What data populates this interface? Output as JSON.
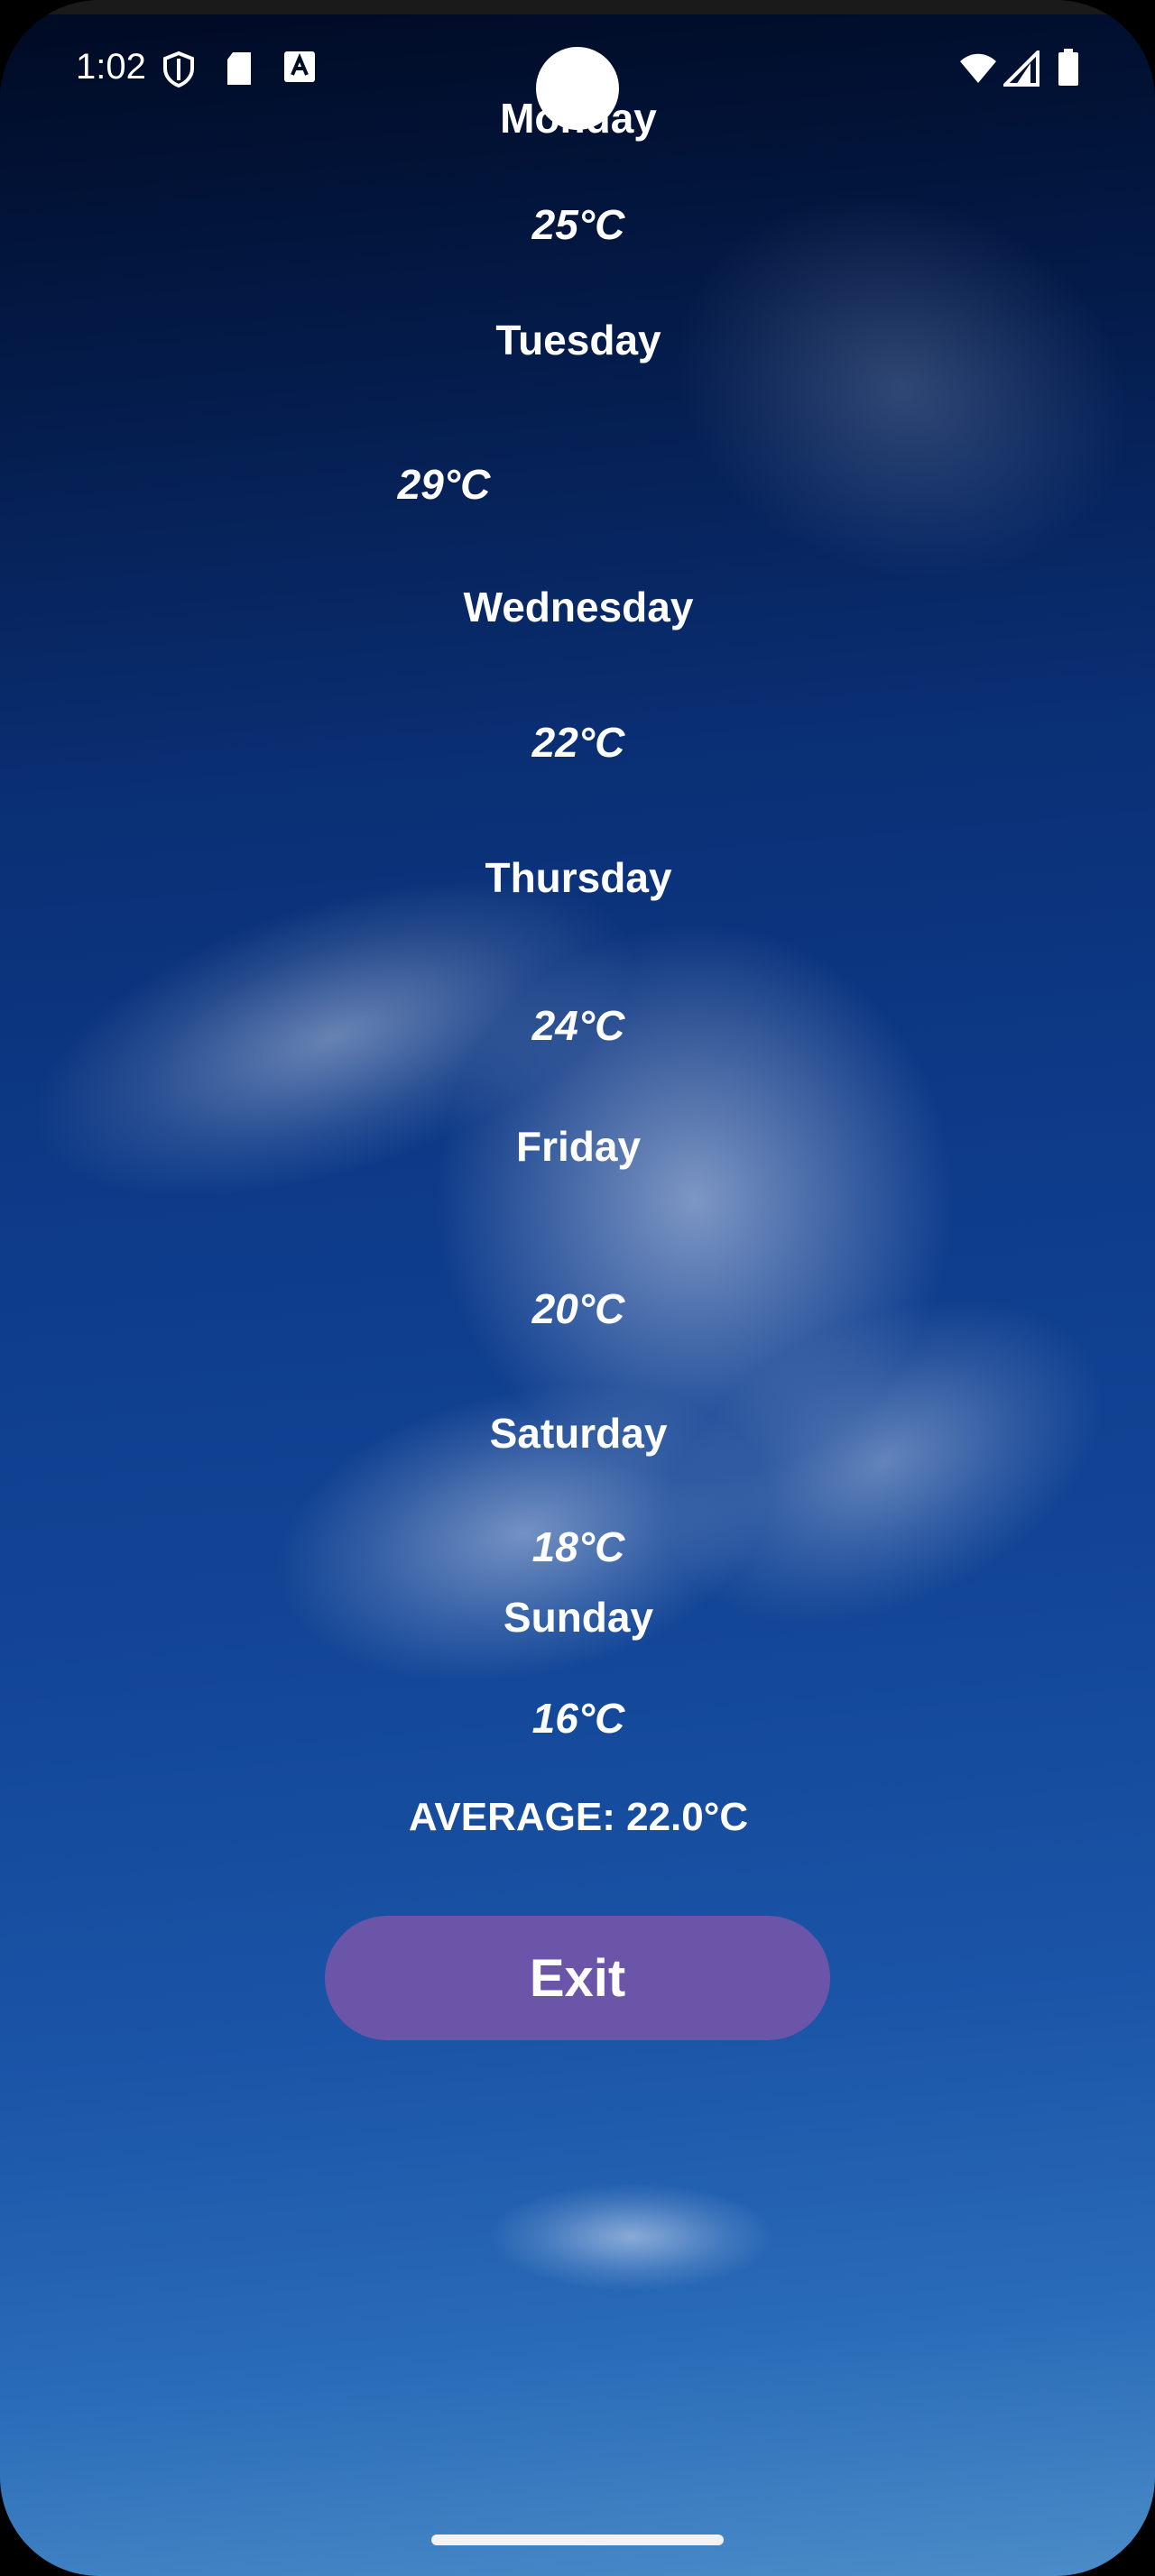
{
  "status_bar": {
    "time": "1:02",
    "icons": [
      "shield-icon",
      "sd-card-icon",
      "font-a-icon",
      "wifi-icon",
      "cellular-signal-icon",
      "battery-icon"
    ]
  },
  "forecast": [
    {
      "day": "Monday",
      "temp": "25°C"
    },
    {
      "day": "Tuesday",
      "temp": "29°C"
    },
    {
      "day": "Wednesday",
      "temp": "22°C"
    },
    {
      "day": "Thursday",
      "temp": "24°C"
    },
    {
      "day": "Friday",
      "temp": "20°C"
    },
    {
      "day": "Saturday",
      "temp": "18°C"
    },
    {
      "day": "Sunday",
      "temp": "16°C"
    }
  ],
  "average": {
    "label": "AVERAGE: 22.0°C"
  },
  "exit_button": {
    "label": "Exit"
  },
  "colors": {
    "button": "#6b55a8",
    "text": "#ffffff",
    "sky_dark": "#000a22",
    "sky_light": "#4b8cc8"
  }
}
